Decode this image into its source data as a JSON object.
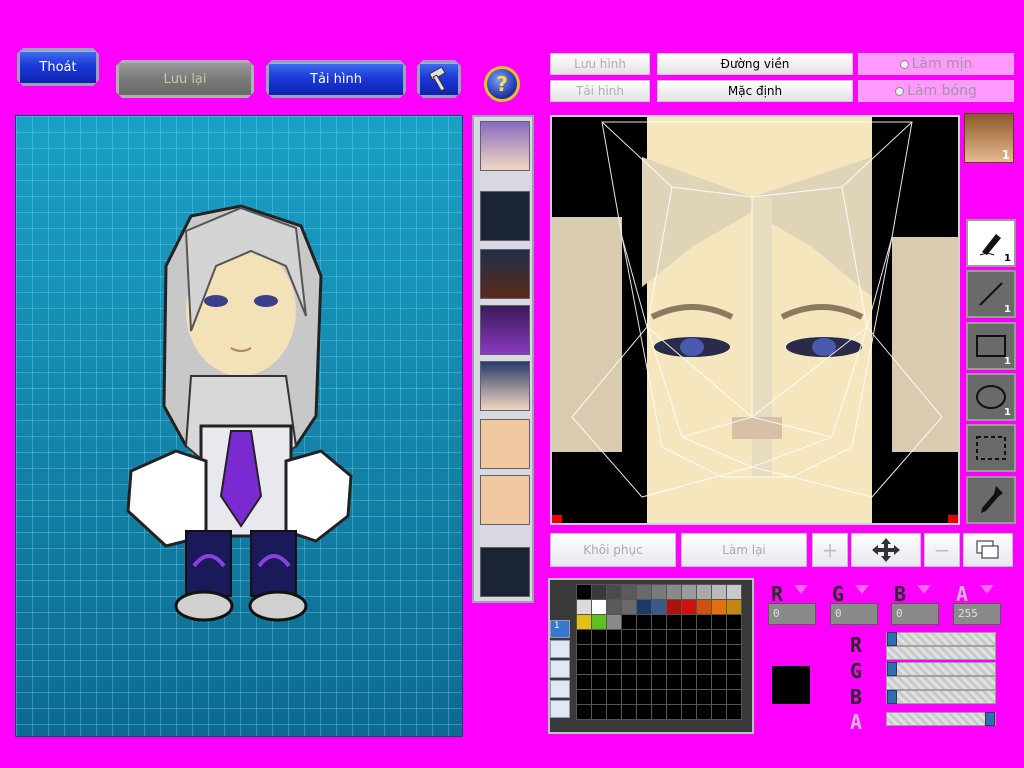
{
  "top_buttons": {
    "exit": "Thoát",
    "save": "Lưu lại",
    "load": "Tải hình"
  },
  "editor_toolbar": {
    "save_image": "Lưu hình",
    "load_image": "Tải hình",
    "outline": "Đường viền",
    "default": "Mặc định",
    "smooth": "Làm mịn",
    "shade": "Làm bóng"
  },
  "editor_actions": {
    "restore": "Khôi phục",
    "redo": "Làm lại"
  },
  "tools": [
    {
      "icon": "pen-icon",
      "count": "1"
    },
    {
      "icon": "line-icon",
      "count": "1"
    },
    {
      "icon": "rectangle-icon",
      "count": "1"
    },
    {
      "icon": "ellipse-icon",
      "count": "1"
    },
    {
      "icon": "select-icon",
      "count": ""
    },
    {
      "icon": "eyedropper-icon",
      "count": ""
    }
  ],
  "preview_badge": "1",
  "palette": {
    "tab_label": "1",
    "colors": [
      "#000000",
      "#3a3a3a",
      "#4a4a4a",
      "#5a5a5a",
      "#6a6a6a",
      "#7a7a7a",
      "#8a8a8a",
      "#9a9a9a",
      "#aaaaaa",
      "#bababa",
      "#cacaca",
      "#dcdcdc",
      "#ffffff",
      "#5a5a5a",
      "#6a6a6a",
      "#1a3a6a",
      "#3a5a8a",
      "#b01010",
      "#d01010",
      "#d05010",
      "#e07010",
      "#c08a10",
      "#e0c010",
      "#60c020",
      "#8a8a8a"
    ]
  },
  "color": {
    "labels": {
      "r": "R",
      "g": "G",
      "b": "B",
      "a": "A"
    },
    "values": {
      "r": "0",
      "g": "0",
      "b": "0",
      "a": "255"
    },
    "slider_levels": {
      "r": 0,
      "g": 0,
      "b": 0,
      "a": 1
    },
    "current": "#000000"
  },
  "colors": {
    "background": "#ff00ff",
    "accent_blue": "#1b3ad8"
  }
}
